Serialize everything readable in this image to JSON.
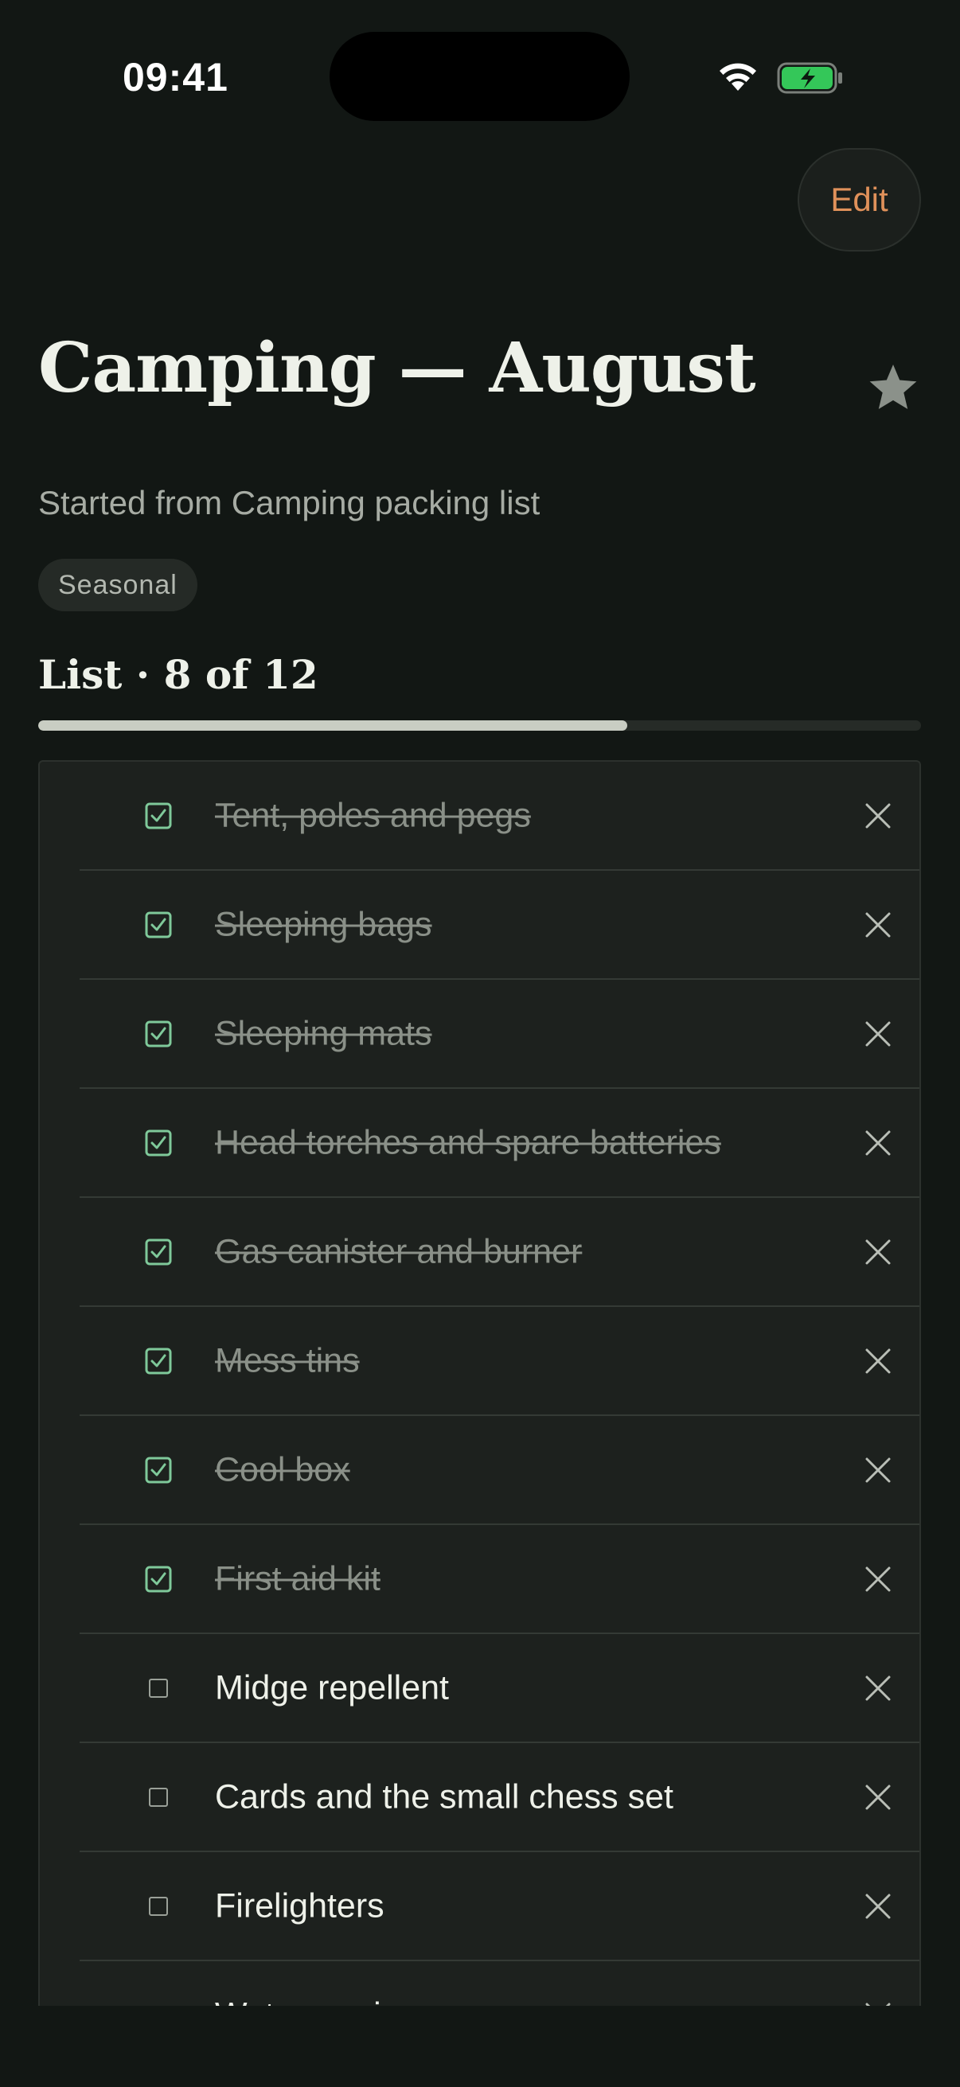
{
  "status_bar": {
    "time": "09:41"
  },
  "header": {
    "edit_label": "Edit",
    "favorite_icon": "star-icon"
  },
  "title": "Camping — August",
  "subtitle": "Started from Camping packing list",
  "tag": "Seasonal",
  "list": {
    "heading": "List · 8 of 12",
    "done_count": 8,
    "total_count": 12,
    "progress_fraction": 0.667,
    "items": [
      {
        "label": "Tent, poles and pegs",
        "checked": true
      },
      {
        "label": "Sleeping bags",
        "checked": true
      },
      {
        "label": "Sleeping mats",
        "checked": true
      },
      {
        "label": "Head torches and spare batteries",
        "checked": true
      },
      {
        "label": "Gas canister and burner",
        "checked": true
      },
      {
        "label": "Mess tins",
        "checked": true
      },
      {
        "label": "Cool box",
        "checked": true
      },
      {
        "label": "First aid kit",
        "checked": true
      },
      {
        "label": "Midge repellent",
        "checked": false
      },
      {
        "label": "Cards and the small chess set",
        "checked": false
      },
      {
        "label": "Firelighters",
        "checked": false
      },
      {
        "label": "Water carrier",
        "checked": false
      }
    ]
  },
  "colors": {
    "background": "#121714",
    "accent": "#e0915a",
    "check_green": "#7fc99a",
    "progress_fill": "#c9cdc3"
  }
}
